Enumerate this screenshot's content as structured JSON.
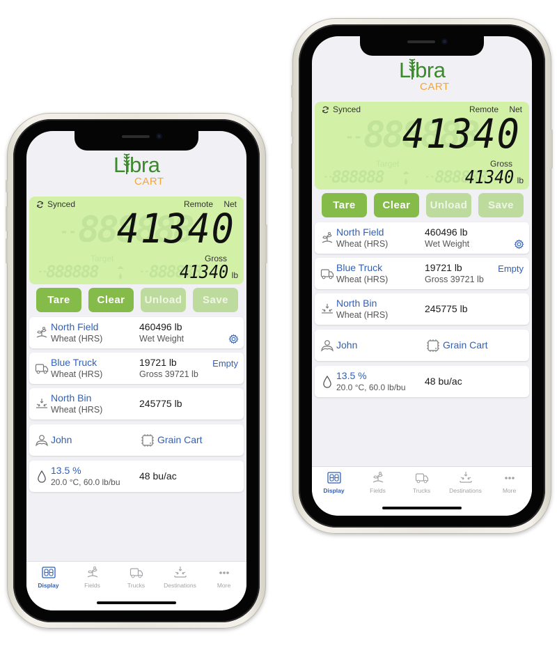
{
  "app": {
    "logo_text": "Libra",
    "logo_subtext": "CART"
  },
  "colors": {
    "lcd_background": "#d2f1a7",
    "button_active": "#85bb48",
    "button_disabled": "#bedb9e",
    "link_blue": "#2f5fb8",
    "logo_green": "#3b8a2c",
    "logo_orange": "#f0a73a"
  },
  "phones": [
    {
      "label": "left",
      "lcd": {
        "sync_icon": "sync-icon",
        "sync_label": "Synced",
        "remote_label": "Remote",
        "net_label": "Net",
        "main_value": "41340",
        "ghost_digits": "888888",
        "target_label": "Target",
        "gross_label": "Gross",
        "gross_value": "41340",
        "unit": "lb"
      },
      "buttons": [
        {
          "label": "Tare",
          "enabled": true
        },
        {
          "label": "Clear",
          "enabled": true
        },
        {
          "label": "Unload",
          "enabled": false
        },
        {
          "label": "Save",
          "enabled": false
        }
      ],
      "cards": {
        "field": {
          "icon": "plant-icon",
          "name": "North Field",
          "crop": "Wheat (HRS)",
          "weight": "460496 lb",
          "weight_type": "Wet Weight",
          "action_icon": "gear-icon"
        },
        "truck": {
          "icon": "truck-icon",
          "name": "Blue Truck",
          "crop": "Wheat (HRS)",
          "weight": "19721 lb",
          "gross": "Gross 39721 lb",
          "action": "Empty"
        },
        "bin": {
          "icon": "bin-unload-icon",
          "name": "North Bin",
          "crop": "Wheat (HRS)",
          "weight": "245775 lb"
        },
        "operator": {
          "icon": "person-icon",
          "name": "John",
          "device_icon": "chip-icon",
          "device": "Grain Cart"
        },
        "moisture": {
          "icon": "drop-icon",
          "value": "13.5 %",
          "details": "20.0 °C, 60.0 lb/bu",
          "yield": "48 bu/ac"
        }
      }
    },
    {
      "label": "right",
      "lcd": {
        "sync_icon": "sync-icon",
        "sync_label": "Synced",
        "remote_label": "Remote",
        "net_label": "Net",
        "main_value": "41340",
        "ghost_digits": "888888",
        "target_label": "Target",
        "gross_label": "Gross",
        "gross_value": "41340",
        "unit": "lb"
      },
      "buttons": [
        {
          "label": "Tare",
          "enabled": true
        },
        {
          "label": "Clear",
          "enabled": true
        },
        {
          "label": "Unload",
          "enabled": false
        },
        {
          "label": "Save",
          "enabled": false
        }
      ],
      "cards": {
        "field": {
          "icon": "plant-icon",
          "name": "North Field",
          "crop": "Wheat (HRS)",
          "weight": "460496 lb",
          "weight_type": "Wet Weight",
          "action_icon": "gear-icon"
        },
        "truck": {
          "icon": "truck-icon",
          "name": "Blue Truck",
          "crop": "Wheat (HRS)",
          "weight": "19721 lb",
          "gross": "Gross 39721 lb",
          "action": "Empty"
        },
        "bin": {
          "icon": "bin-unload-icon",
          "name": "North Bin",
          "crop": "Wheat (HRS)",
          "weight": "245775 lb"
        },
        "operator": {
          "icon": "person-icon",
          "name": "John",
          "device_icon": "chip-icon",
          "device": "Grain Cart"
        },
        "moisture": {
          "icon": "drop-icon",
          "value": "13.5 %",
          "details": "20.0 °C, 60.0 lb/bu",
          "yield": "48 bu/ac"
        }
      }
    }
  ],
  "tabbar": {
    "tabs": [
      {
        "label": "Display",
        "icon": "display-88-icon",
        "active": true
      },
      {
        "label": "Fields",
        "icon": "plant-icon",
        "active": false
      },
      {
        "label": "Trucks",
        "icon": "truck-icon",
        "active": false
      },
      {
        "label": "Destinations",
        "icon": "bin-unload-icon",
        "active": false
      },
      {
        "label": "More",
        "icon": "more-dots-icon",
        "active": false
      }
    ]
  }
}
